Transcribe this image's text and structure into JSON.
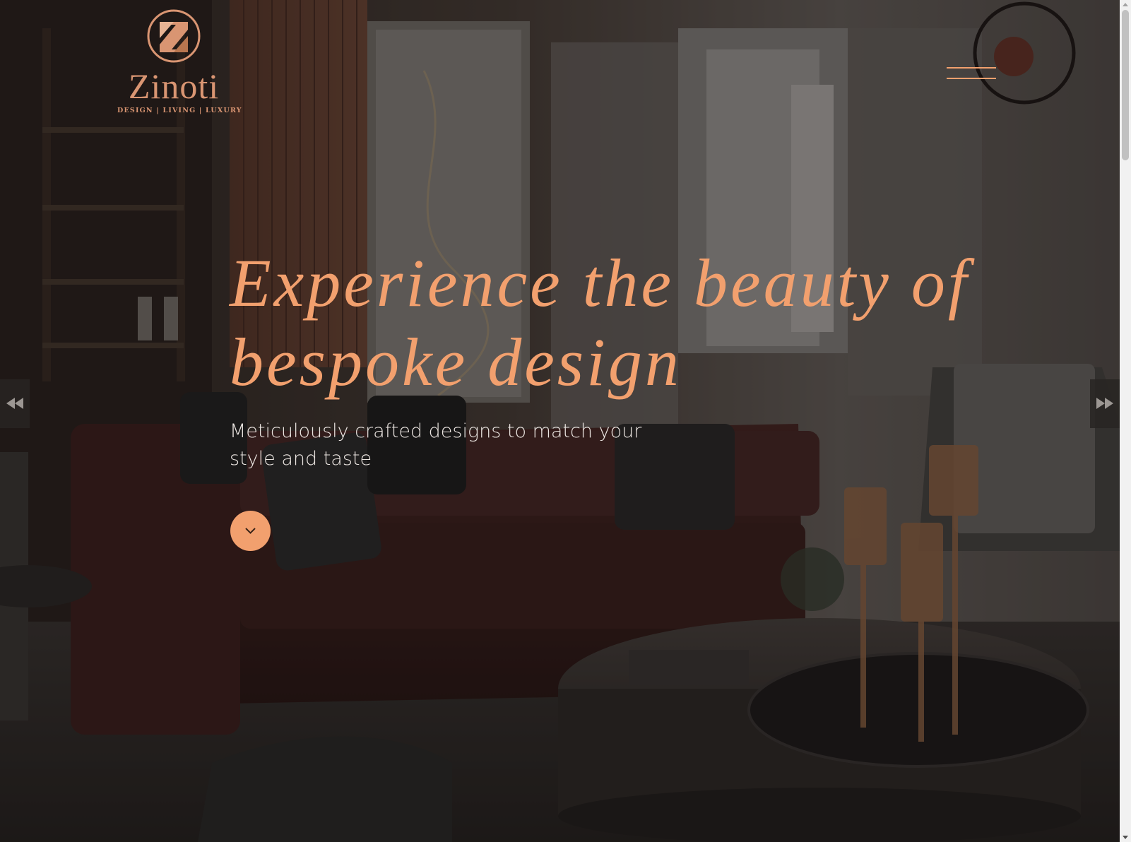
{
  "brand": {
    "name": "Zinoti",
    "tagline": "DESIGN | LIVING | LUXURY",
    "mark_letter": "Z",
    "color": "#d99572"
  },
  "nav": {
    "menu_icon": "hamburger-menu-icon"
  },
  "hero": {
    "title": "Experience the beauty of bespoke design",
    "subtitle": "Meticulously crafted designs to match your style and taste",
    "scroll_icon": "chevron-down-icon",
    "accent_color": "#f2a06e"
  },
  "slider": {
    "prev_icon": "double-chevron-left-icon",
    "next_icon": "double-chevron-right-icon"
  },
  "background": {
    "description_icon": "living-room-photo"
  }
}
